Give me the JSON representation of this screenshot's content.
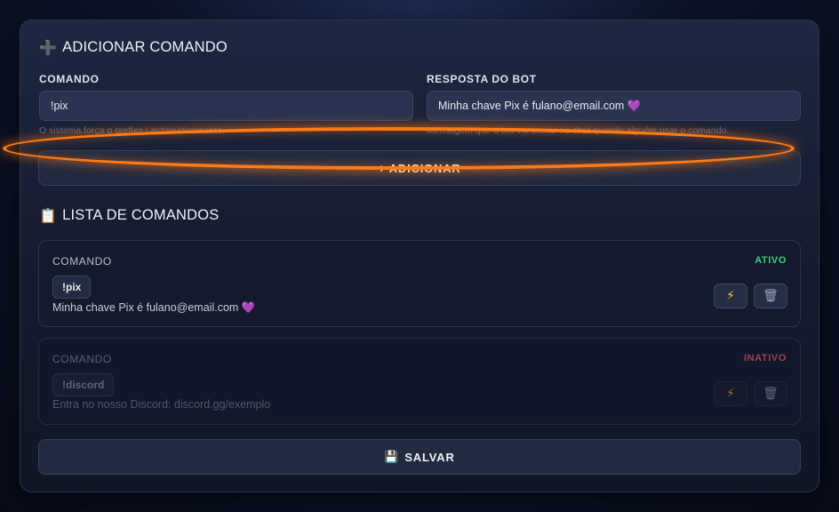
{
  "add_section": {
    "icon": "plus-square-icon",
    "icon_glyph": "➕",
    "title": "ADICIONAR COMANDO",
    "command_label": "COMANDO",
    "command_value": "!pix",
    "command_hint": "O sistema força o prefixo ! automaticamente.",
    "response_label": "RESPOSTA DO BOT",
    "response_value": "Minha chave Pix é fulano@email.com",
    "response_hint": "Mensagem que o bot vai enviar no chat quando alguém usar o comando.",
    "add_button": "+ ADICIONAR"
  },
  "list_section": {
    "icon": "clipboard-icon",
    "icon_glyph": "📋",
    "title": "LISTA DE COMANDOS",
    "commands": [
      {
        "label": "COMANDO",
        "status": "ATIVO",
        "name": "!pix",
        "response": "Minha chave Pix é fulano@email.com",
        "active": true
      },
      {
        "label": "COMANDO",
        "status": "INATIVO",
        "name": "!discord",
        "response": "Entra no nosso Discord: discord.gg/exemplo",
        "active": false
      }
    ],
    "toggle_icon": "lightning-icon",
    "toggle_glyph": "⚡",
    "delete_icon": "trash-icon",
    "delete_glyph": "🗑",
    "heart_glyph": "💜"
  },
  "save_button": {
    "icon": "floppy-disk-icon",
    "icon_glyph": "💾",
    "label": "SALVAR"
  },
  "colors": {
    "accent_highlight": "#ff7a14",
    "active": "#33d17a",
    "inactive": "#a3414d"
  }
}
